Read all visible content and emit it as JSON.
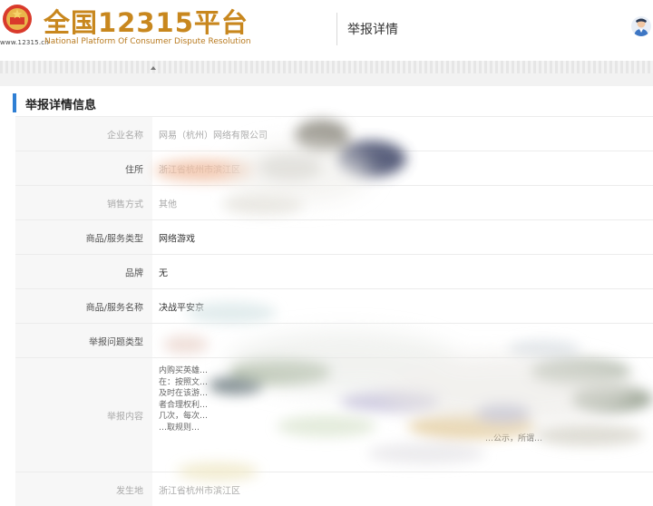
{
  "header": {
    "site_url": "www.12315.cn",
    "logo_title": "全国12315平台",
    "logo_subtitle": "National Platform Of Consumer Dispute Resolution",
    "page_title": "举报详情"
  },
  "section": {
    "title": "举报详情信息"
  },
  "rows": [
    {
      "label": "企业名称",
      "value": "网易（杭州）网络有限公司"
    },
    {
      "label": "住所",
      "value": "浙江省杭州市滨江区"
    },
    {
      "label": "销售方式",
      "value": "其他"
    },
    {
      "label": "商品/服务类型",
      "value": "网络游戏"
    },
    {
      "label": "品牌",
      "value": "无"
    },
    {
      "label": "商品/服务名称",
      "value": "决战平安京"
    },
    {
      "label": "举报问题类型",
      "value": ""
    },
    {
      "label": "举报内容",
      "value": ""
    },
    {
      "label": "发生地",
      "value": "浙江省杭州市滨江区"
    }
  ],
  "report_content_lines": [
    "内购买英雄…",
    "在：按照文…",
    "及时在该游…",
    "者合理权利…",
    "几次，每次…",
    "…取规则…",
    "…公示，所谓…"
  ],
  "colors": {
    "brand_gold": "#c8871e",
    "section_accent": "#2f7fd4"
  }
}
